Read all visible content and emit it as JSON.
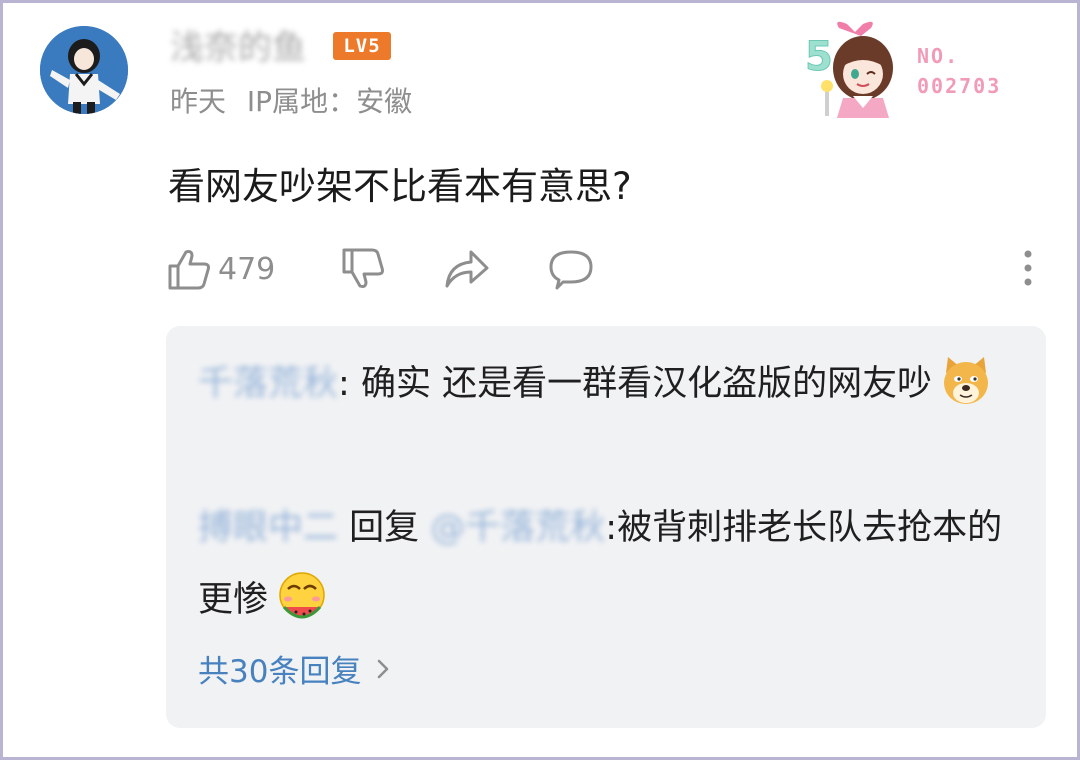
{
  "post": {
    "username": "浅奈的鱼",
    "level_badge": "LV5",
    "time": "昨天",
    "ip_location": "IP属地：安徽",
    "content": "看网友吵架不比看本有意思?",
    "fan_card": {
      "number_label": "NO.",
      "number": "002703",
      "card_digit": "5"
    }
  },
  "actions": {
    "like_count": "479",
    "like_icon": "thumbs-up-icon",
    "dislike_icon": "thumbs-down-icon",
    "share_icon": "share-arrow-icon",
    "comment_icon": "comment-bubble-icon",
    "more_icon": "more-vertical-icon"
  },
  "replies": [
    {
      "author": "千落荒秋",
      "separator": ":",
      "text": " 确实 还是看一群看汉化盗版的网友吵",
      "emoji": "doge-emoji"
    },
    {
      "author": "搏眼中二",
      "reply_word": " 回复 ",
      "mention": "@千落荒秋",
      "text": ":被背刺排老长队去抢本的更惨",
      "emoji": "watermelon-face-emoji"
    }
  ],
  "more_replies": {
    "label": "共30条回复",
    "icon": "chevron-right-icon"
  },
  "colors": {
    "level_badge": "#ec7a2a",
    "fan_number": "#f19bb8",
    "link_blue": "#4782bf",
    "reply_bg": "#f1f2f4",
    "meta_gray": "#8e8e8e"
  }
}
